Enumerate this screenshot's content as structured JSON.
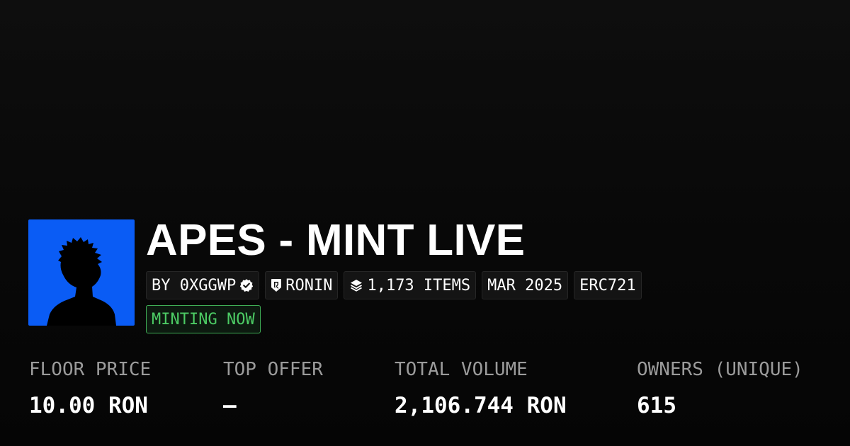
{
  "collection": {
    "title": "APES - MINT LIVE",
    "creator": "BY 0XGGWP",
    "creator_verified_icon": "verified-badge-icon",
    "chain": "RONIN",
    "chain_icon": "ronin-shield-icon",
    "items": "1,173 ITEMS",
    "items_icon": "layers-icon",
    "date": "MAR 2025",
    "standard": "ERC721",
    "status": "MINTING NOW"
  },
  "stats": [
    {
      "label": "FLOOR PRICE",
      "value": "10.00 RON"
    },
    {
      "label": "TOP OFFER",
      "value": "–"
    },
    {
      "label": "TOTAL VOLUME",
      "value": "2,106.744 RON"
    },
    {
      "label": "OWNERS (UNIQUE)",
      "value": "615"
    }
  ],
  "colors": {
    "background": "#0a0a0a",
    "avatar_background": "#0a5cf5",
    "status_green": "#4ccb64",
    "label_gray": "#9b9b9b"
  }
}
